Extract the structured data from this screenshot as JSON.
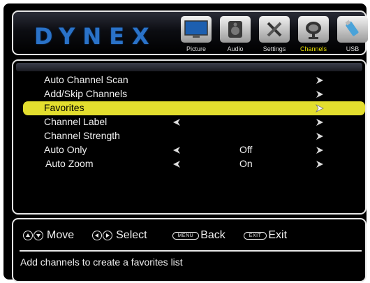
{
  "brand": "DYNEX",
  "tabs": [
    {
      "label": "Picture",
      "icon": "picture-icon",
      "active": false
    },
    {
      "label": "Audio",
      "icon": "audio-icon",
      "active": false
    },
    {
      "label": "Settings",
      "icon": "settings-icon",
      "active": false
    },
    {
      "label": "Channels",
      "icon": "channels-icon",
      "active": true
    },
    {
      "label": "USB",
      "icon": "usb-icon",
      "active": false
    }
  ],
  "menu": {
    "items": [
      {
        "label": "Auto Channel Scan",
        "value": "",
        "left_arrow": false
      },
      {
        "label": "Add/Skip Channels",
        "value": "",
        "left_arrow": false
      },
      {
        "label": "Favorites",
        "value": "",
        "left_arrow": false,
        "selected": true
      },
      {
        "label": "Channel Label",
        "value": "",
        "left_arrow": true
      },
      {
        "label": "Channel Strength",
        "value": "",
        "left_arrow": false
      },
      {
        "label": "Auto Only",
        "value": "Off",
        "left_arrow": true
      },
      {
        "label": "Auto Zoom",
        "value": "On",
        "left_arrow": true
      }
    ]
  },
  "footer": {
    "move": "Move",
    "select": "Select",
    "menu_key": "MENU",
    "back": "Back",
    "exit_key": "EXIT",
    "exit": "Exit",
    "description": "Add channels to create a favorites list"
  },
  "colors": {
    "highlight": "#e3de2e",
    "active_tab_text": "#e8e000",
    "logo": "#2a72c8"
  }
}
